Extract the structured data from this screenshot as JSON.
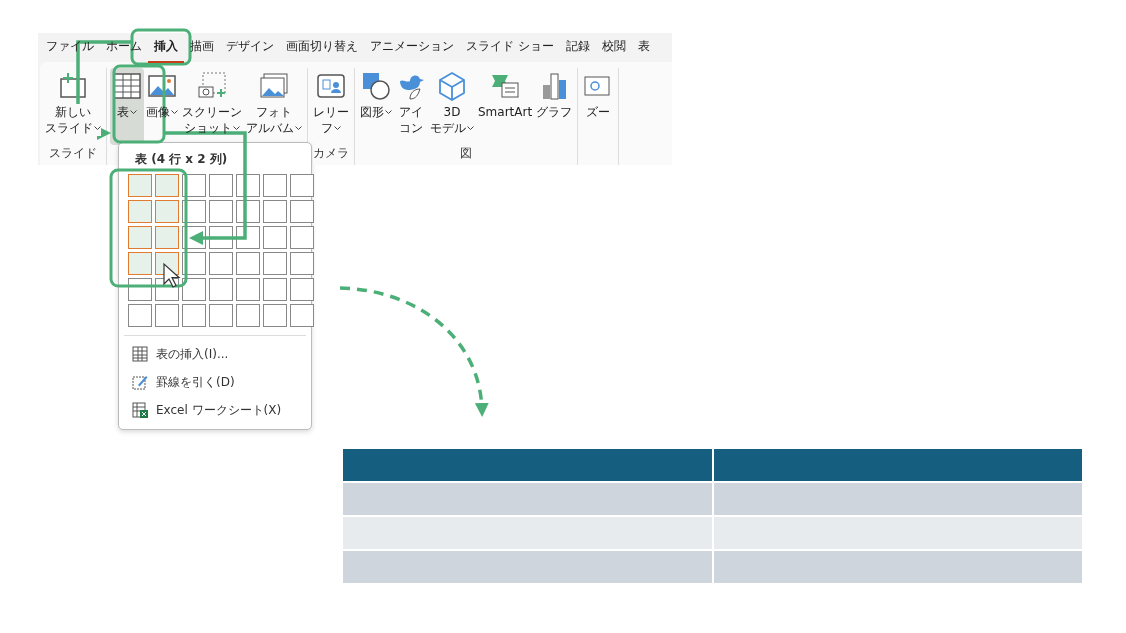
{
  "ribbon": {
    "tabs": [
      {
        "label": "ファイル",
        "selected": false
      },
      {
        "label": "ホーム",
        "selected": false
      },
      {
        "label": "挿入",
        "selected": true
      },
      {
        "label": "描画",
        "selected": false
      },
      {
        "label": "デザイン",
        "selected": false
      },
      {
        "label": "画面切り替え",
        "selected": false
      },
      {
        "label": "アニメーション",
        "selected": false
      },
      {
        "label": "スライド ショー",
        "selected": false
      },
      {
        "label": "記録",
        "selected": false
      },
      {
        "label": "校閲",
        "selected": false
      },
      {
        "label": "表",
        "selected": false
      }
    ],
    "groups": [
      {
        "label": "スライド",
        "items": [
          {
            "kind": "slide",
            "lines": [
              "新しい",
              "スライド"
            ],
            "dropdown": true,
            "selected": false
          }
        ]
      },
      {
        "items": [
          {
            "kind": "table",
            "lines": [
              "表"
            ],
            "dropdown": true,
            "selected": true
          },
          {
            "kind": "picture",
            "lines": [
              "画像"
            ],
            "dropdown": true,
            "selected": false
          },
          {
            "kind": "screenshot",
            "lines": [
              "スクリーン",
              "ショット"
            ],
            "dropdown": true,
            "selected": false
          },
          {
            "kind": "album",
            "lines": [
              "フォト",
              "アルバム"
            ],
            "dropdown": true,
            "selected": false
          }
        ]
      },
      {
        "label": "カメラ",
        "items": [
          {
            "kind": "cameo",
            "lines": [
              "レリー",
              "フ"
            ],
            "dropdown": true,
            "selected": false
          }
        ]
      },
      {
        "label": "図",
        "items": [
          {
            "kind": "shapes",
            "lines": [
              "図形"
            ],
            "dropdown": true,
            "selected": false
          },
          {
            "kind": "icons",
            "lines": [
              "アイ",
              "コン"
            ],
            "dropdown": false,
            "selected": false
          },
          {
            "kind": "cube",
            "lines": [
              "3D",
              "モデル"
            ],
            "dropdown": true,
            "selected": false
          },
          {
            "kind": "smartart",
            "lines": [
              "SmartArt"
            ],
            "dropdown": false,
            "selected": false
          },
          {
            "kind": "chart",
            "lines": [
              "グラフ"
            ],
            "dropdown": false,
            "selected": false
          }
        ]
      },
      {
        "items": [
          {
            "kind": "zoom",
            "lines": [
              "ズー"
            ],
            "dropdown": false,
            "selected": false
          }
        ]
      }
    ]
  },
  "table_menu": {
    "title": "表 (4 行 x 2 列)",
    "grid": [
      [
        {
          "selected": true
        },
        {
          "selected": true
        },
        {
          "selected": false
        },
        {
          "selected": false
        },
        {
          "selected": false
        },
        {
          "selected": false
        },
        {
          "selected": false
        }
      ],
      [
        {
          "selected": true
        },
        {
          "selected": true
        },
        {
          "selected": false
        },
        {
          "selected": false
        },
        {
          "selected": false
        },
        {
          "selected": false
        },
        {
          "selected": false
        }
      ],
      [
        {
          "selected": true
        },
        {
          "selected": true
        },
        {
          "selected": false
        },
        {
          "selected": false
        },
        {
          "selected": false
        },
        {
          "selected": false
        },
        {
          "selected": false
        }
      ],
      [
        {
          "selected": true
        },
        {
          "selected": true
        },
        {
          "selected": false
        },
        {
          "selected": false
        },
        {
          "selected": false
        },
        {
          "selected": false
        },
        {
          "selected": false
        }
      ],
      [
        {
          "selected": false
        },
        {
          "selected": false
        },
        {
          "selected": false
        },
        {
          "selected": false
        },
        {
          "selected": false
        },
        {
          "selected": false
        },
        {
          "selected": false
        }
      ],
      [
        {
          "selected": false
        },
        {
          "selected": false
        },
        {
          "selected": false
        },
        {
          "selected": false
        },
        {
          "selected": false
        },
        {
          "selected": false
        },
        {
          "selected": false
        }
      ]
    ],
    "items": [
      {
        "kind": "table",
        "label": "表の挿入(I)..."
      },
      {
        "kind": "draw",
        "label": "罫線を引く(D)"
      },
      {
        "kind": "excel",
        "label": "Excel ワークシート(X)"
      }
    ]
  },
  "result_table": {
    "columns": [
      {
        "kind": "cell"
      },
      {
        "kind": "cell"
      }
    ],
    "rows": [
      {
        "kind": "header"
      },
      {
        "kind": "dark"
      },
      {
        "kind": "light"
      },
      {
        "kind": "dark"
      }
    ]
  }
}
